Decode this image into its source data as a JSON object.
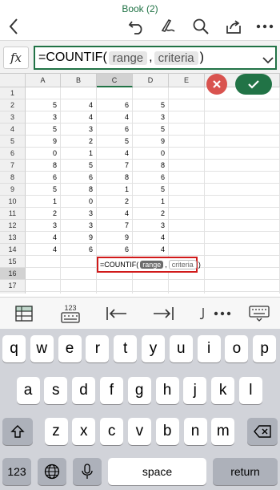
{
  "app": {
    "title": "Book (2)",
    "accent": "#217346"
  },
  "topbar": {
    "icons": [
      "back-icon",
      "undo-icon",
      "draw-icon",
      "search-icon",
      "share-icon",
      "more-icon"
    ]
  },
  "formula_bar": {
    "fx_label": "fx",
    "function_text": "=COUNTIF(",
    "arg1": "range",
    "separator": ",",
    "arg2": "criteria",
    "close_paren": ")"
  },
  "grid": {
    "columns": [
      "A",
      "B",
      "C",
      "D",
      "E"
    ],
    "selected_column": "C",
    "selected_row": "16",
    "rows": [
      {
        "n": "1",
        "cells": [
          "",
          "",
          "",
          "",
          ""
        ]
      },
      {
        "n": "2",
        "cells": [
          "5",
          "4",
          "6",
          "5",
          ""
        ]
      },
      {
        "n": "3",
        "cells": [
          "3",
          "4",
          "4",
          "3",
          ""
        ]
      },
      {
        "n": "4",
        "cells": [
          "5",
          "3",
          "6",
          "5",
          ""
        ]
      },
      {
        "n": "5",
        "cells": [
          "9",
          "2",
          "5",
          "9",
          ""
        ]
      },
      {
        "n": "6",
        "cells": [
          "0",
          "1",
          "4",
          "0",
          ""
        ]
      },
      {
        "n": "7",
        "cells": [
          "8",
          "5",
          "7",
          "8",
          ""
        ]
      },
      {
        "n": "8",
        "cells": [
          "6",
          "6",
          "8",
          "6",
          ""
        ]
      },
      {
        "n": "9",
        "cells": [
          "5",
          "8",
          "1",
          "5",
          ""
        ]
      },
      {
        "n": "10",
        "cells": [
          "1",
          "0",
          "2",
          "1",
          ""
        ]
      },
      {
        "n": "11",
        "cells": [
          "2",
          "3",
          "4",
          "2",
          ""
        ]
      },
      {
        "n": "12",
        "cells": [
          "3",
          "3",
          "7",
          "3",
          ""
        ]
      },
      {
        "n": "13",
        "cells": [
          "4",
          "9",
          "9",
          "4",
          ""
        ]
      },
      {
        "n": "14",
        "cells": [
          "4",
          "6",
          "6",
          "4",
          ""
        ]
      },
      {
        "n": "15",
        "cells": [
          "",
          "",
          "",
          "",
          ""
        ]
      },
      {
        "n": "16",
        "cells": [
          "",
          "",
          "",
          "",
          ""
        ]
      },
      {
        "n": "17",
        "cells": [
          "",
          "",
          "",
          "",
          ""
        ]
      },
      {
        "n": "18",
        "cells": [
          "",
          "",
          "",
          "",
          ""
        ]
      }
    ],
    "edit_cell": {
      "function_text": "=COUNTIF(",
      "arg1": "range",
      "separator": ",",
      "arg2": "criteria",
      "close_paren": ")"
    }
  },
  "actions": {
    "cancel_icon": "close-icon",
    "confirm_icon": "checkmark-icon",
    "cancel_color": "#d9534f"
  },
  "keyboard_toolbar": {
    "numeric_label": "123",
    "icons": [
      "sheet-grid-icon",
      "numeric-keypad-icon",
      "tab-left-icon",
      "tab-right-icon",
      "more-icon",
      "keyboard-icon"
    ]
  },
  "keyboard": {
    "row1": [
      "q",
      "w",
      "e",
      "r",
      "t",
      "y",
      "u",
      "i",
      "o",
      "p"
    ],
    "row2": [
      "a",
      "s",
      "d",
      "f",
      "g",
      "h",
      "j",
      "k",
      "l"
    ],
    "row3": [
      "z",
      "x",
      "c",
      "v",
      "b",
      "n",
      "m"
    ],
    "numbers_key": "123",
    "space_key": "space",
    "return_key": "return"
  }
}
